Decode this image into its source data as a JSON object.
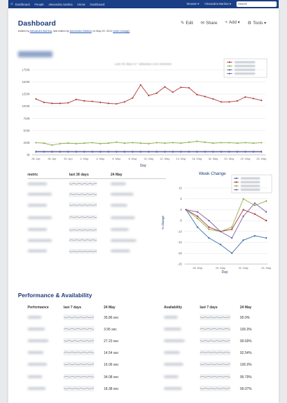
{
  "topbar": {
    "crumbs": [
      "Dashboard",
      "People",
      "alexandra.martina",
      "Home",
      "Dashboard"
    ],
    "browse": "Browse ▾",
    "user": "Alexandra Martina ▾",
    "search_placeholder": "Search"
  },
  "header": {
    "title": "Dashboard",
    "meta_prefix": "Added by",
    "author": "Alexandra Martina",
    "meta_mid": ", last edited by",
    "editor": "Alexandra Martina",
    "meta_date": "on May 20, 2011",
    "view_change": "(view change)",
    "edit": "Edit",
    "share": "Share",
    "add": "Add ▾",
    "tools": "Tools ▾"
  },
  "colors": {
    "brand": "#1b3f86",
    "red": "#b03a3a",
    "green": "#8fb04a",
    "blue": "#3d6fb0",
    "purple": "#7b5fa8"
  },
  "chart_data": [
    {
      "type": "line",
      "title": "Last 30 days in * atlassian.com websites",
      "xlabel": "Day",
      "ylim": [
        0,
        1750000
      ],
      "yticks": [
        "0k",
        "250k",
        "500k",
        "750k",
        "1000k",
        "1250k",
        "1500k",
        "1750k"
      ],
      "xticks": [
        "26. Apr",
        "28. Apr",
        "30. Apr",
        "2. May",
        "4. May",
        "6. May",
        "8. May",
        "10. May",
        "12. May",
        "14. May",
        "16. May",
        "18. May",
        "20. May",
        "22. May",
        "24. May"
      ],
      "series": [
        {
          "color": "#b03a3a",
          "values": [
            1150000,
            1080000,
            1060000,
            1060000,
            1070000,
            1140000,
            1110000,
            1100000,
            1080000,
            1060000,
            1050000,
            1090000,
            1170000,
            1440000,
            1220000,
            1270000,
            1400000,
            1290000,
            1390000,
            1380000,
            1240000,
            1200000,
            1150000,
            1090000,
            1090000,
            1110000,
            1190000,
            1160000,
            1120000
          ]
        },
        {
          "color": "#8fb04a",
          "values": [
            250000,
            240000,
            200000,
            230000,
            240000,
            230000,
            240000,
            250000,
            230000,
            240000,
            260000,
            240000,
            250000,
            240000,
            230000,
            250000,
            240000,
            250000,
            240000,
            260000,
            280000,
            260000,
            240000,
            250000,
            250000,
            240000,
            250000,
            240000,
            250000
          ]
        },
        {
          "color": "#3d6fb0",
          "values": [
            60000,
            60000,
            60000,
            60000,
            60000,
            60000,
            60000,
            60000,
            60000,
            60000,
            60000,
            60000,
            60000,
            60000,
            60000,
            60000,
            60000,
            60000,
            60000,
            60000,
            60000,
            60000,
            60000,
            60000,
            60000,
            60000,
            60000,
            60000,
            60000
          ]
        },
        {
          "color": "#7b5fa8",
          "values": [
            70000,
            70000,
            70000,
            70000,
            70000,
            70000,
            70000,
            70000,
            70000,
            70000,
            70000,
            70000,
            70000,
            70000,
            70000,
            70000,
            70000,
            70000,
            70000,
            70000,
            70000,
            70000,
            70000,
            70000,
            70000,
            70000,
            70000,
            70000,
            70000
          ]
        }
      ]
    },
    {
      "type": "line",
      "title": "Week Change",
      "xlabel": "Day",
      "ylabel": "% change",
      "ylim": [
        -25,
        10
      ],
      "yticks": [
        "10",
        "5",
        "0",
        "-5",
        "-10",
        "-15",
        "-20",
        "-25"
      ],
      "xticks": [
        "18. May",
        "20. May",
        "22. May",
        "24. May"
      ],
      "series": [
        {
          "color": "#3d6fb0",
          "values": [
            0,
            -8,
            -13,
            -16,
            -20,
            -14,
            -12,
            -13
          ]
        },
        {
          "color": "#b03a3a",
          "values": [
            0,
            -3,
            -8,
            -10,
            -9,
            0,
            -2,
            -5
          ]
        },
        {
          "color": "#8fb04a",
          "values": [
            0,
            -4,
            -9,
            -10,
            -8,
            5,
            2,
            4
          ]
        },
        {
          "color": "#7b5fa8",
          "values": [
            0,
            -1,
            -5,
            -10,
            -13,
            -3,
            3,
            -1
          ]
        }
      ]
    }
  ],
  "metrics": {
    "headers": [
      "metric",
      "last 30 days",
      "24 May"
    ],
    "rows": 7
  },
  "performance": {
    "title": "Performance & Availability",
    "perf_headers": [
      "Performance",
      "last 7 days",
      "24 May"
    ],
    "perf_values": [
      "35.86 sec",
      "3.95 sec",
      "27.23 sec",
      "14.54 sec",
      "16.06 sec",
      "34.08 sec",
      "18.38 sec"
    ],
    "avail_headers": [
      "Availability",
      "last 7 days",
      "24 May"
    ],
    "avail_values": [
      "99.9%",
      "100.0%",
      "99.69%",
      "92.54%",
      "100.0%",
      "99.79%",
      "99.07%"
    ]
  }
}
